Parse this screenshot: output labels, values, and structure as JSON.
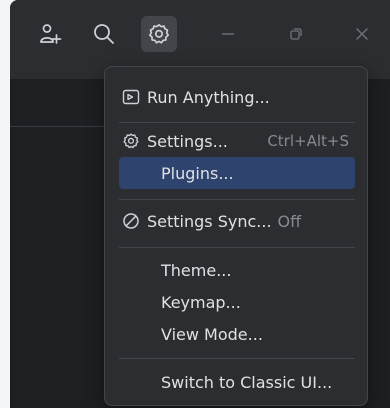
{
  "toolbar": {
    "buttons": [
      {
        "name": "add-user-icon"
      },
      {
        "name": "search-icon"
      },
      {
        "name": "gear-icon",
        "active": true
      },
      {
        "name": "minimize-icon"
      },
      {
        "name": "restore-icon"
      },
      {
        "name": "close-icon"
      }
    ]
  },
  "menu": {
    "run_anything": "Run Anything...",
    "settings": "Settings...",
    "settings_shortcut": "Ctrl+Alt+S",
    "plugins": "Plugins...",
    "settings_sync": "Settings Sync...",
    "settings_sync_status": "Off",
    "theme": "Theme...",
    "keymap": "Keymap...",
    "view_mode": "View Mode...",
    "switch_classic": "Switch to Classic UI..."
  },
  "colors": {
    "menu_bg": "#2b2d30",
    "highlight": "#2e436e",
    "text": "#dfe1e5",
    "muted_text": "#868a91"
  }
}
